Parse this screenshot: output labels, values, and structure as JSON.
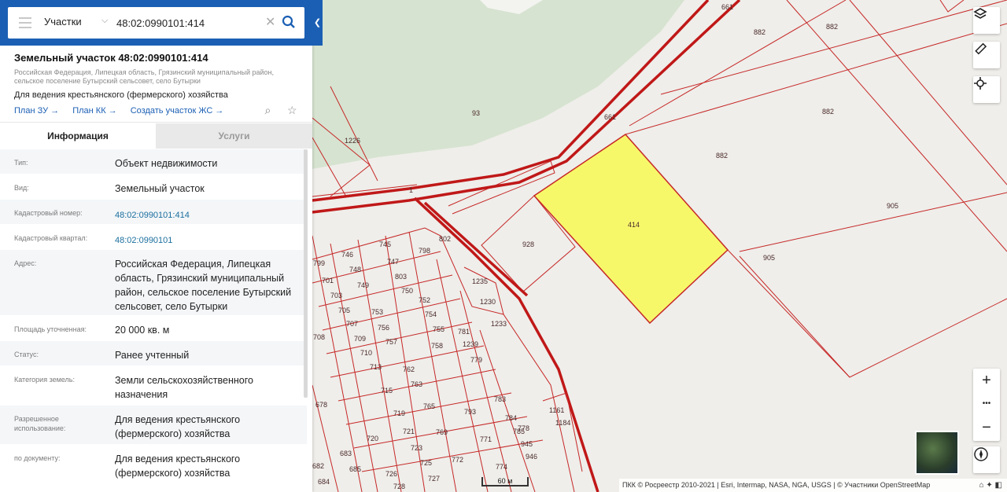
{
  "search": {
    "category": "Участки",
    "value": "48:02:0990101:414"
  },
  "object": {
    "title": "Земельный участок 48:02:0990101:414",
    "address": "Российская Федерация, Липецкая область, Грязинский муниципальный район, сельское поселение Бутырский сельсовет, село Бутырки",
    "purpose": "Для ведения крестьянского (фермерского) хозяйства",
    "links": [
      "План ЗУ",
      "План КК",
      "Создать участок ЖС"
    ]
  },
  "tabs": {
    "info": "Информация",
    "services": "Услуги"
  },
  "info": [
    {
      "key": "Тип:",
      "value": "Объект недвижимости"
    },
    {
      "key": "Вид:",
      "value": "Земельный участок"
    },
    {
      "key": "Кадастровый номер:",
      "value": "48:02:0990101:414"
    },
    {
      "key": "Кадастровый квартал:",
      "value": "48:02:0990101"
    },
    {
      "key": "Адрес:",
      "value": "Российская Федерация, Липецкая область, Грязинский муниципальный район, сельское поселение Бутырский сельсовет, село Бутырки"
    },
    {
      "key": "Площадь уточненная:",
      "value": "20 000 кв. м"
    },
    {
      "key": "Статус:",
      "value": "Ранее учтенный"
    },
    {
      "key": "Категория земель:",
      "value": "Земли сельскохозяйственного назначения"
    },
    {
      "key": "Разрешенное использование:",
      "value": "Для ведения крестьянского (фермерского) хозяйства"
    },
    {
      "key": "по документу:",
      "value": "Для ведения крестьянского (фермерского) хозяйства"
    }
  ],
  "map": {
    "parcel_labels": [
      "414",
      "882",
      "882",
      "882",
      "882",
      "905",
      "905",
      "928",
      "93",
      "661",
      "661",
      "1226",
      "1",
      "745",
      "746",
      "747",
      "748",
      "749",
      "750",
      "752",
      "753",
      "754",
      "755",
      "756",
      "757",
      "758",
      "762",
      "763",
      "765",
      "769",
      "771",
      "772",
      "774",
      "778",
      "779",
      "781",
      "783",
      "784",
      "785",
      "793",
      "798",
      "799",
      "701",
      "703",
      "705",
      "707",
      "708",
      "709",
      "710",
      "713",
      "715",
      "719",
      "720",
      "721",
      "723",
      "725",
      "726",
      "727",
      "728",
      "802",
      "803",
      "1161",
      "1184",
      "1230",
      "1233",
      "1235",
      "1239",
      "945",
      "946",
      "678",
      "682",
      "683",
      "684",
      "685"
    ],
    "highlight_color": "#f7f76a",
    "scale_label": "60 м",
    "attribution": "ПКК © Росреестр 2010-2021 | Esri, Intermap, NASA, NGA, USGS | © Участники OpenStreetMap",
    "zoom_in": "+",
    "zoom_more": "•••",
    "zoom_out": "−"
  }
}
